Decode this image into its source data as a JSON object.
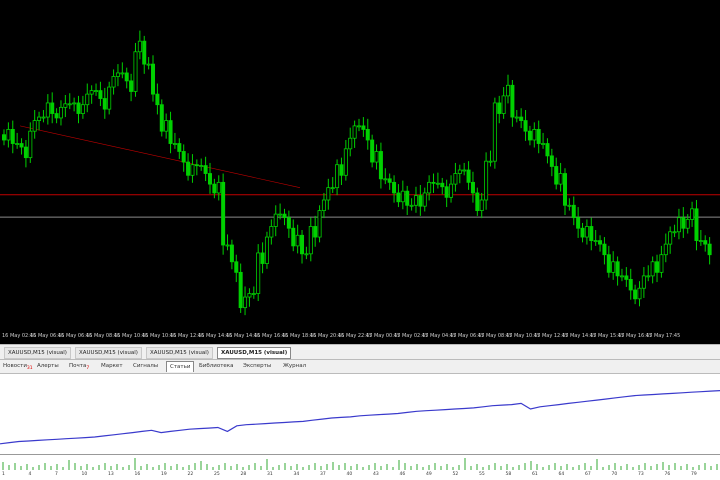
{
  "colors": {
    "bull": "#00d000",
    "bear": "#00d000",
    "background": "#000000",
    "red_line": "#c00000",
    "gray_line": "#8a8a8a",
    "equity_line": "#3a3acc",
    "volume_bar": "#33aa33"
  },
  "chart_data": {
    "type": "candlestick",
    "x_labels": [
      "16 May 02:45",
      "16 May 06:45",
      "16 May 06:45",
      "16 May 08:45",
      "16 May 10:45",
      "16 May 10:45",
      "16 May 12:45",
      "16 May 14:45",
      "16 May 14:45",
      "16 May 16:45",
      "16 May 18:45",
      "16 May 20:45",
      "16 May 22:45",
      "17 May 00:45",
      "17 May 02:45",
      "17 May 04:45",
      "17 May 06:45",
      "17 May 08:45",
      "17 May 10:45",
      "17 May 12:45",
      "17 May 14:45",
      "17 May 15:45",
      "17 May 16:45",
      "17 May 17:45"
    ],
    "series": [
      {
        "values": [
          1.6,
          1.58,
          1.56,
          1.62,
          1.64,
          1.66,
          1.65,
          1.67,
          1.66,
          1.68,
          1.7,
          1.67,
          1.72,
          1.74,
          1.71,
          1.8,
          1.76,
          1.68,
          1.62,
          1.58,
          1.55,
          1.52,
          1.53,
          1.5,
          1.48,
          1.35,
          1.3,
          1.22,
          1.24,
          1.32,
          1.38,
          1.42,
          1.4,
          1.36,
          1.33,
          1.38,
          1.44,
          1.48,
          1.52,
          1.58,
          1.62,
          1.6,
          1.55,
          1.5,
          1.48,
          1.46,
          1.44,
          1.45,
          1.48,
          1.49,
          1.47,
          1.5,
          1.52,
          1.48,
          1.44,
          1.54,
          1.66,
          1.7,
          1.64,
          1.62,
          1.6,
          1.58,
          1.54,
          1.5,
          1.44,
          1.4,
          1.38,
          1.36,
          1.34,
          1.3,
          1.28,
          1.26,
          1.24,
          1.28,
          1.3,
          1.34,
          1.38,
          1.4,
          1.42,
          1.36,
          1.34
        ]
      }
    ],
    "reference_lines": [
      1.445,
      1.465
    ]
  },
  "time_axis": {
    "labels": [
      "16 May 02:45",
      "16 May 06:45",
      "16 May 06:45",
      "16 May 08:45",
      "16 May 10:45",
      "16 May 10:45",
      "16 May 12:45",
      "16 May 14:45",
      "16 May 14:45",
      "16 May 16:45",
      "16 May 18:45",
      "16 May 20:45",
      "16 May 22:45",
      "17 May 00:45",
      "17 May 02:45",
      "17 May 04:45",
      "17 May 06:45",
      "17 May 08:45",
      "17 May 10:45",
      "17 May 12:45",
      "17 May 14:45",
      "17 May 15:45",
      "17 May 16:45",
      "17 May 17:45"
    ]
  },
  "chart_tabs": [
    {
      "label": "XAUUSD,M15 (visual)",
      "active": false
    },
    {
      "label": "XAUUSD,M15 (visual)",
      "active": false
    },
    {
      "label": "XAUUSD,M15 (visual)",
      "active": false
    },
    {
      "label": "XAUUSD,M15 (visual)",
      "active": true
    }
  ],
  "terminal_tabs": [
    {
      "label": "Новости",
      "badge": "31",
      "active": false
    },
    {
      "label": "Алерты",
      "badge": "",
      "active": false
    },
    {
      "label": "Почта",
      "badge": "7",
      "active": false
    },
    {
      "label": "Маркет",
      "badge": "",
      "active": false
    },
    {
      "label": "Сигналы",
      "badge": "",
      "active": false
    },
    {
      "label": "Статьи",
      "badge": "",
      "active": true
    },
    {
      "label": "Библиотека",
      "badge": "",
      "active": false
    },
    {
      "label": "Эксперты",
      "badge": "",
      "active": false
    },
    {
      "label": "Журнал",
      "badge": "",
      "active": false
    }
  ],
  "equity": {
    "values": [
      0.04,
      0.06,
      0.08,
      0.09,
      0.1,
      0.11,
      0.12,
      0.13,
      0.14,
      0.15,
      0.16,
      0.18,
      0.2,
      0.22,
      0.24,
      0.26,
      0.28,
      0.24,
      0.26,
      0.28,
      0.3,
      0.31,
      0.32,
      0.33,
      0.26,
      0.36,
      0.38,
      0.39,
      0.4,
      0.41,
      0.42,
      0.43,
      0.44,
      0.46,
      0.48,
      0.5,
      0.51,
      0.52,
      0.54,
      0.55,
      0.56,
      0.57,
      0.58,
      0.6,
      0.62,
      0.63,
      0.64,
      0.65,
      0.66,
      0.67,
      0.68,
      0.7,
      0.72,
      0.73,
      0.74,
      0.76,
      0.66,
      0.7,
      0.72,
      0.74,
      0.76,
      0.78,
      0.8,
      0.82,
      0.84,
      0.86,
      0.88,
      0.9,
      0.91,
      0.92,
      0.93,
      0.94,
      0.95,
      0.96,
      0.97,
      0.98,
      0.99
    ]
  },
  "volume_axis": {
    "labels": [
      "1",
      "4",
      "7",
      "10",
      "13",
      "16",
      "19",
      "22",
      "25",
      "28",
      "31",
      "34",
      "37",
      "40",
      "43",
      "46",
      "49",
      "52",
      "55",
      "58",
      "61",
      "64",
      "67",
      "70",
      "73",
      "76",
      "79"
    ]
  }
}
